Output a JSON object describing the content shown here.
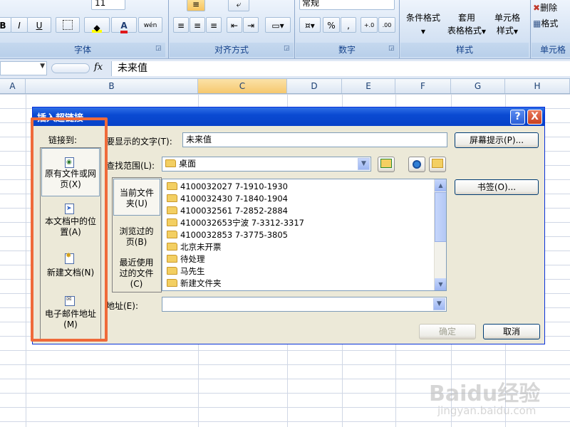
{
  "ribbon": {
    "font_size_value": "11",
    "number_format_value": "常规",
    "bold": "B",
    "italic": "I",
    "underline": "U",
    "font_color_letter": "A",
    "phonetic_label": "wén",
    "percent": "%",
    "comma": ",",
    "dec_increase": "+.0",
    "dec_decrease": ".00",
    "groups": {
      "font": "字体",
      "alignment": "对齐方式",
      "number": "数字",
      "styles": "样式",
      "cells": "单元格"
    },
    "conditional_format": "条件格式",
    "table_format_1": "套用",
    "table_format_2": "表格格式",
    "cell_styles_1": "单元格",
    "cell_styles_2": "样式",
    "delete": "删除",
    "format": "格式"
  },
  "formula_bar": {
    "fx": "fx",
    "content": "未来值"
  },
  "columns": [
    "A",
    "B",
    "C",
    "D",
    "E",
    "F",
    "G",
    "H"
  ],
  "dialog": {
    "title": "插入超链接",
    "help": "?",
    "close": "X",
    "link_to_label": "链接到:",
    "sidebar": [
      {
        "line1": "原有文件或网",
        "line2": "页(X)"
      },
      {
        "line1": "本文档中的位",
        "line2": "置(A)"
      },
      {
        "line1": "新建文档(N)",
        "line2": ""
      },
      {
        "line1": "电子邮件地址",
        "line2": "(M)"
      }
    ],
    "text_to_display_label": "要显示的文字(T):",
    "text_to_display_value": "未来值",
    "screentip_button": "屏幕提示(P)...",
    "look_in_label": "查找范围(L):",
    "look_in_value": "桌面",
    "bookmark_button": "书签(O)...",
    "look_in_sections": [
      {
        "line1": "当前文件",
        "line2": "夹(U)"
      },
      {
        "line1": "浏览过的",
        "line2": "页(B)"
      },
      {
        "line1": "最近使用",
        "line2": "过的文件",
        "line3": "(C)"
      }
    ],
    "files": [
      "4100032027  7-1910-1930",
      "4100032430  7-1840-1904",
      "4100032561  7-2852-2884",
      "4100032653宁波  7-3312-3317",
      "4100032853  7-3775-3805",
      "北京未开票",
      "待处理",
      "马先生",
      "新建文件夹"
    ],
    "address_label": "地址(E):",
    "address_value": "",
    "ok_button": "确定",
    "cancel_button": "取消"
  },
  "watermark": {
    "brand": "Baidu经验",
    "url": "jingyan.baidu.com"
  },
  "colors": {
    "highlight_box": "#ef6a3a",
    "title_bar": "#0a4ad2",
    "selected_column": "#f9d99b"
  }
}
